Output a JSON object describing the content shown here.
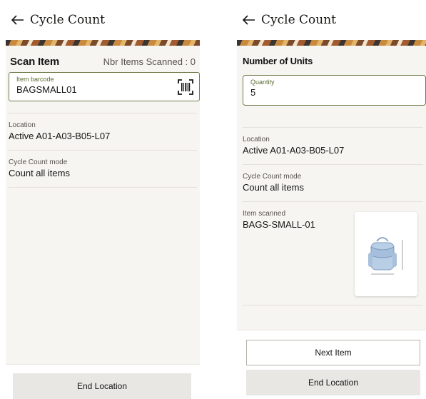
{
  "left": {
    "header": {
      "title": "Cycle Count"
    },
    "scan": {
      "title": "Scan Item",
      "count_label": "Nbr Items Scanned : 0"
    },
    "barcode_field": {
      "label": "Item barcode",
      "value": "BAGSMALL01"
    },
    "location": {
      "label": "Location",
      "value": "Active A01-A03-B05-L07"
    },
    "mode": {
      "label": "Cycle Count mode",
      "value": "Count all items"
    },
    "footer": {
      "end_location": "End Location"
    }
  },
  "right": {
    "header": {
      "title": "Cycle Count"
    },
    "section": {
      "title": "Number of Units"
    },
    "quantity_field": {
      "label": "Quantity",
      "value": "5"
    },
    "location": {
      "label": "Location",
      "value": "Active A01-A03-B05-L07"
    },
    "mode": {
      "label": "Cycle Count mode",
      "value": "Count all items"
    },
    "item": {
      "label": "Item scanned",
      "value": "BAGS-SMALL-01"
    },
    "footer": {
      "next_item": "Next Item",
      "end_location": "End Location"
    }
  },
  "colors": {
    "field_border": "#6f7b4a",
    "label_green": "#5a6b2f",
    "button_fill": "#e9e7e4",
    "panel_bg": "#f7f5f2"
  },
  "icons": [
    "back-arrow-icon",
    "barcode-scan-icon",
    "backpack-image"
  ]
}
